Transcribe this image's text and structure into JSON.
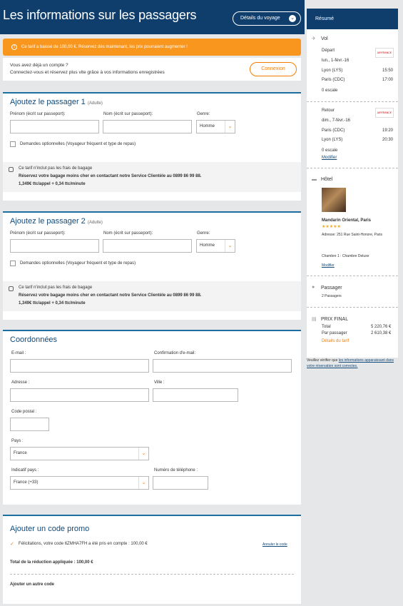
{
  "header": {
    "title": "Les informations sur les passagers",
    "details_button": "Détails du voyage",
    "chevron_glyph": "⌄"
  },
  "alert": {
    "icon_glyph": "!",
    "text": "Ce tarif a baissé de 100,00 €. Réservez dès maintenant, les prix pourraient augmenter !"
  },
  "account": {
    "question": "Vous avez déjà un compte ?",
    "text": "Connectez-vous et réservez plus vite grâce à vos informations enregistrées",
    "login_button": "Connexion"
  },
  "passengers": [
    {
      "title": "Ajoutez le passager 1",
      "type": "(Adulte)",
      "first_name_label": "Prénom (écrit sur passeport):",
      "last_name_label": "Nom (écrit sur passeport):",
      "gender_label": "Genre:",
      "gender_value": "Homme",
      "optional_label": "Demandes optionnelles (Voyageur fréquent et type de repas)",
      "bag_title": "Ce tarif n'inclut pas les frais de bagage",
      "bag_line1": "Réservez votre bagage moins cher en contactant notre Service Clientèle au 0899 86 99 88.",
      "bag_line2": "1,349€ ttc/appel + 0,34 ttc/minute"
    },
    {
      "title": "Ajoutez le passager 2",
      "type": "(Adulte)",
      "first_name_label": "Prénom (écrit sur passeport):",
      "last_name_label": "Nom (écrit sur passeport):",
      "gender_label": "Genre:",
      "gender_value": "Homme",
      "optional_label": "Demandes optionnelles (Voyageur fréquent et type de repas)",
      "bag_title": "Ce tarif n'inclut pas les frais de bagage",
      "bag_line1": "Réservez votre bagage moins cher en contactant notre Service Clientèle au 0899 86 99 88.",
      "bag_line2": "1,349€ ttc/appel + 0,34 ttc/minute"
    }
  ],
  "select_arrow": "⌄",
  "contact": {
    "title": "Coordonnées",
    "email_label": "E-mail :",
    "email_confirm_label": "Confirmation d'e-mail:",
    "address_label": "Adresse :",
    "city_label": "Ville :",
    "postal_label": "Code postal :",
    "country_label": "Pays :",
    "country_value": "France",
    "dial_label": "Indicatif pays :",
    "dial_value": "France (+33)",
    "phone_label": "Numéro de téléphone :"
  },
  "promo": {
    "title": "Ajouter un code promo",
    "check_glyph": "✓",
    "success_text": "Félicitations, votre code 6ZMHA7FH a été pris en compte : 100,00 €",
    "cancel_link": "Annuler le code",
    "total_text": "Total de la réduction appliquée : 100,00 €",
    "add_another": "Ajouter un autre code"
  },
  "summary": {
    "header": "Résumé",
    "flight_label": "Vol",
    "airline_logo": "AIRFRANCE",
    "outbound": {
      "label": "Départ",
      "date": "lun., 1-févr.-16",
      "from": "Lyon (LYS)",
      "from_time": "15:50",
      "to": "Paris (CDC)",
      "to_time": "17:00",
      "stops": "0 escale"
    },
    "return": {
      "label": "Retour",
      "date": "dim., 7-févr.-16",
      "from": "Paris (CDC)",
      "from_time": "19:20",
      "to": "Lyon (LYS)",
      "to_time": "20:30",
      "stops": "0 escale",
      "modify": "Modifier"
    },
    "hotel_label": "Hôtel",
    "hotel_name": "Mandarin Oriental, Paris",
    "stars": "★★★★★",
    "address": "Adresse: 251 Rue Saint-Honore, Paris",
    "room": "Chambre 1 : Chambre Deluxe",
    "hotel_modify": "Modifier",
    "passenger_label": "Passager",
    "passenger_count": "2 Passagers",
    "price_label": "PRIX FINAL",
    "total_label": "Total",
    "total_value": "5 220,76 €",
    "per_label": "Par passager",
    "per_value": "2 610,38 €",
    "fare_details": "Détails du tarif"
  },
  "verify": {
    "text": "Veuillez vérifier que",
    "link": "les informations apparaissant dans votre réservation sont correctes."
  }
}
